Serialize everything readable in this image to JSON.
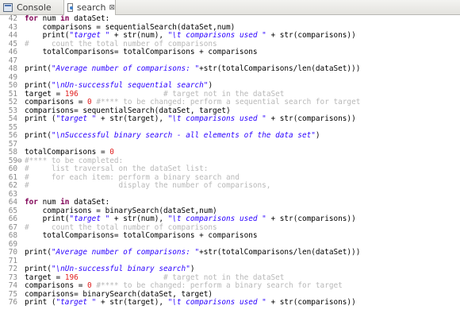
{
  "tabs": [
    {
      "label": "Console",
      "icon": "console-icon",
      "active": false
    },
    {
      "label": "search",
      "icon": "python-file-icon",
      "active": true,
      "close": "⊠"
    }
  ],
  "editor": {
    "lines": [
      {
        "n": "42",
        "m": "",
        "t": [
          [
            "kw",
            "for"
          ],
          [
            "",
            "num "
          ],
          [
            "kw",
            "in"
          ],
          [
            "",
            "dataSet:"
          ]
        ]
      },
      {
        "n": "43",
        "m": "",
        "t": [
          [
            "",
            "    comparisons = sequentialSearch(dataSet,num)"
          ]
        ]
      },
      {
        "n": "44",
        "m": "",
        "t": [
          [
            "",
            "    print("
          ],
          [
            "str",
            "\"target \""
          ],
          [
            "",
            " + str(num), "
          ],
          [
            "str",
            "\"\\t comparisons used \""
          ],
          [
            "",
            " + str(comparisons))"
          ]
        ]
      },
      {
        "n": "45",
        "m": "",
        "t": [
          [
            "cm",
            "#     count the total number of comparisons"
          ]
        ]
      },
      {
        "n": "46",
        "m": "",
        "t": [
          [
            "",
            "    totalComparisons= totalComparisons + comparisons"
          ]
        ]
      },
      {
        "n": "47",
        "m": "",
        "t": []
      },
      {
        "n": "48",
        "m": "",
        "t": [
          [
            "",
            "print("
          ],
          [
            "str",
            "\"Average number of comparisons: \""
          ],
          [
            "",
            "+str(totalComparisons/len(dataSet)))"
          ]
        ]
      },
      {
        "n": "49",
        "m": "",
        "t": []
      },
      {
        "n": "50",
        "m": "",
        "t": [
          [
            "",
            "print("
          ],
          [
            "str",
            "\"\\nUn-successful sequential search\""
          ],
          [
            "",
            ")"
          ]
        ]
      },
      {
        "n": "51",
        "m": "",
        "t": [
          [
            "",
            "target = "
          ],
          [
            "num",
            "196"
          ],
          [
            "",
            "                   "
          ],
          [
            "cm",
            "# target not in the dataSet"
          ]
        ]
      },
      {
        "n": "52",
        "m": "",
        "t": [
          [
            "",
            "comparisons = "
          ],
          [
            "num",
            "0"
          ],
          [
            "",
            " "
          ],
          [
            "cm",
            "#**** to be changed: perform a sequential search for target"
          ]
        ]
      },
      {
        "n": "53",
        "m": "",
        "t": [
          [
            "",
            "comparisons= sequentialSearch(dataSet, target)"
          ]
        ]
      },
      {
        "n": "54",
        "m": "",
        "t": [
          [
            "",
            "print ("
          ],
          [
            "str",
            "\"target \""
          ],
          [
            "",
            " + str(target), "
          ],
          [
            "str",
            "\"\\t comparisons used \""
          ],
          [
            "",
            " + str(comparisons))"
          ]
        ]
      },
      {
        "n": "55",
        "m": "",
        "t": []
      },
      {
        "n": "56",
        "m": "",
        "t": [
          [
            "",
            "print("
          ],
          [
            "str",
            "\"\\nSuccessful binary search - all elements of the data set\""
          ],
          [
            "",
            ")"
          ]
        ]
      },
      {
        "n": "57",
        "m": "",
        "t": []
      },
      {
        "n": "58",
        "m": "",
        "t": [
          [
            "",
            "totalComparisons = "
          ],
          [
            "num",
            "0"
          ]
        ]
      },
      {
        "n": "59",
        "m": "⊖",
        "t": [
          [
            "cm",
            "#**** to be completed:"
          ]
        ]
      },
      {
        "n": "60",
        "m": "",
        "t": [
          [
            "cm",
            "#     list traversal on the dataSet list:"
          ]
        ]
      },
      {
        "n": "61",
        "m": "",
        "t": [
          [
            "cm",
            "#     for each item: perform a binary search and"
          ]
        ]
      },
      {
        "n": "62",
        "m": "",
        "t": [
          [
            "cm",
            "#                    display the number of comparisons,"
          ]
        ]
      },
      {
        "n": "63",
        "m": "",
        "t": []
      },
      {
        "n": "64",
        "m": "",
        "t": [
          [
            "kw",
            "for"
          ],
          [
            "",
            "num "
          ],
          [
            "kw",
            "in"
          ],
          [
            "",
            "dataSet:"
          ]
        ]
      },
      {
        "n": "65",
        "m": "",
        "t": [
          [
            "",
            "    comparisons = binarySearch(dataSet,num)"
          ]
        ]
      },
      {
        "n": "66",
        "m": "",
        "t": [
          [
            "",
            "    print("
          ],
          [
            "str",
            "\"target \""
          ],
          [
            "",
            " + str(num), "
          ],
          [
            "str",
            "\"\\t comparisons used \""
          ],
          [
            "",
            " + str(comparisons))"
          ]
        ]
      },
      {
        "n": "67",
        "m": "",
        "t": [
          [
            "cm",
            "#     count the total number of comparisons"
          ]
        ]
      },
      {
        "n": "68",
        "m": "",
        "t": [
          [
            "",
            "    totalComparisons= totalComparisons + comparisons"
          ]
        ]
      },
      {
        "n": "69",
        "m": "",
        "t": []
      },
      {
        "n": "70",
        "m": "",
        "t": [
          [
            "",
            "print("
          ],
          [
            "str",
            "\"Average number of comparisons: \""
          ],
          [
            "",
            "+str(totalComparisons/len(dataSet)))"
          ]
        ]
      },
      {
        "n": "71",
        "m": "",
        "t": []
      },
      {
        "n": "72",
        "m": "",
        "t": [
          [
            "",
            "print("
          ],
          [
            "str",
            "\"\\nUn-successful binary search\""
          ],
          [
            "",
            ")"
          ]
        ]
      },
      {
        "n": "73",
        "m": "",
        "t": [
          [
            "",
            "target = "
          ],
          [
            "num",
            "196"
          ],
          [
            "",
            "                   "
          ],
          [
            "cm",
            "# target not in the dataSet"
          ]
        ]
      },
      {
        "n": "74",
        "m": "",
        "t": [
          [
            "",
            "comparisons = "
          ],
          [
            "num",
            "0"
          ],
          [
            "",
            " "
          ],
          [
            "cm",
            "#**** to be changed: perform a binary search for target"
          ]
        ]
      },
      {
        "n": "75",
        "m": "",
        "t": [
          [
            "",
            "comparisons= binarySearch(dataSet, target)"
          ]
        ]
      },
      {
        "n": "76",
        "m": "",
        "t": [
          [
            "",
            "print ("
          ],
          [
            "str",
            "\"target \""
          ],
          [
            "",
            " + str(target), "
          ],
          [
            "str",
            "\"\\t comparisons used \""
          ],
          [
            "",
            " + str(comparisons))"
          ]
        ]
      }
    ]
  }
}
